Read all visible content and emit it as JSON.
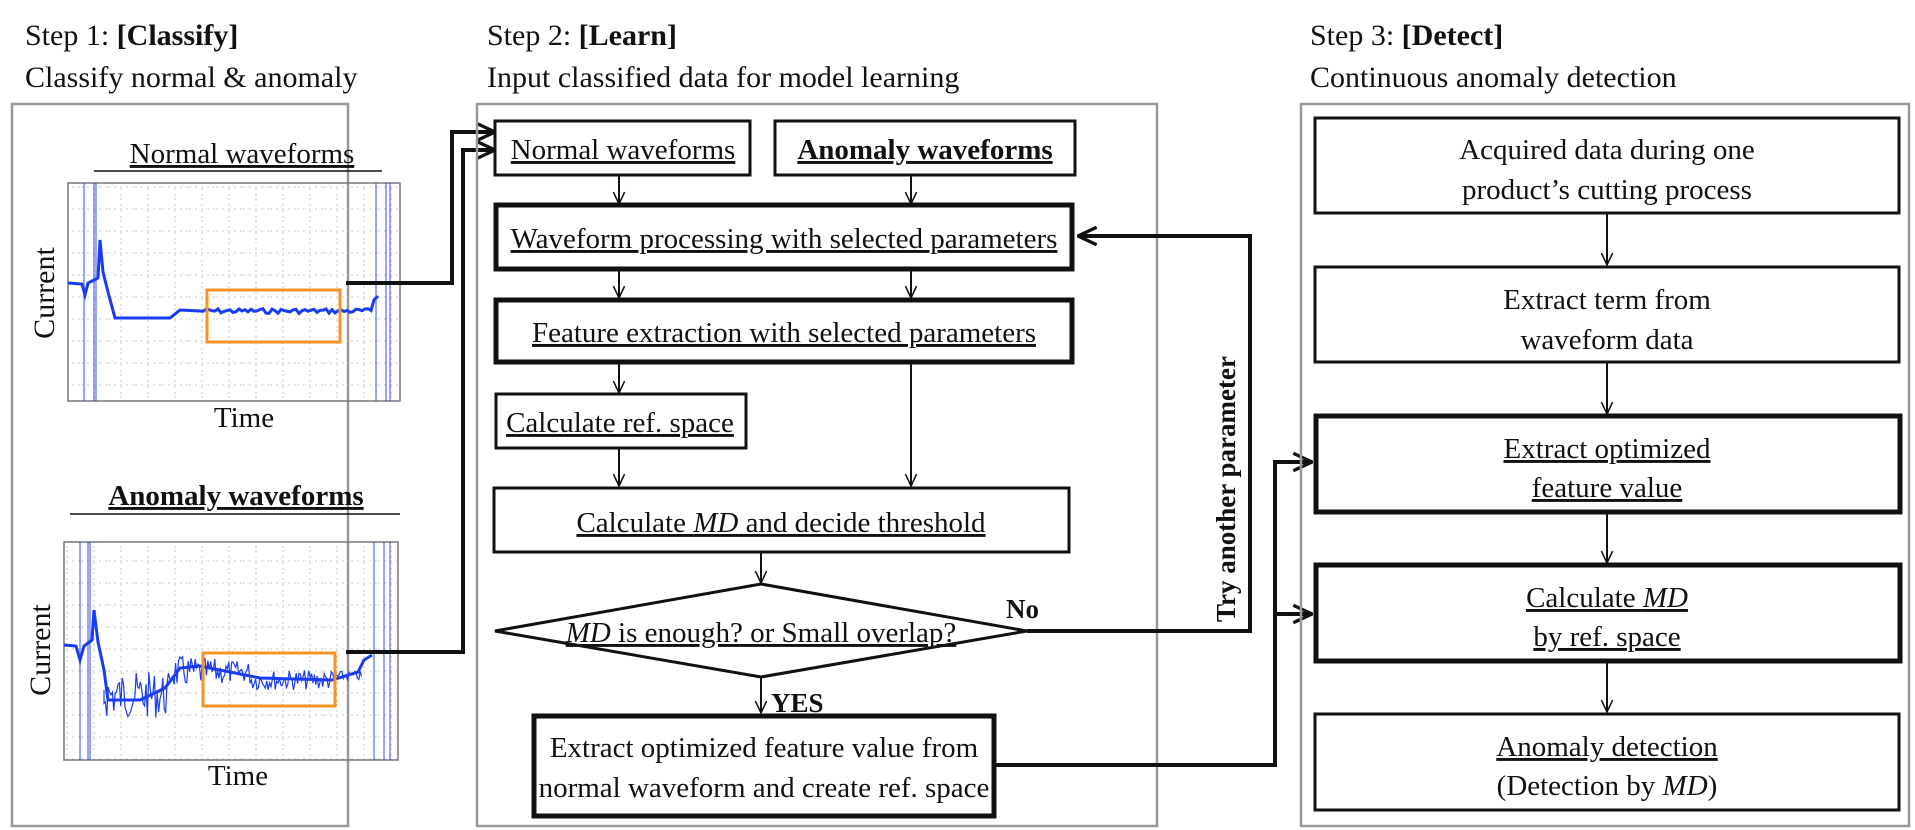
{
  "step1": {
    "prefix": "Step 1: ",
    "tag": "[Classify]",
    "subtitle": "Classify normal & anomaly",
    "normal_title": "Normal waveforms",
    "anomaly_title": "Anomaly waveforms",
    "y_label": "Current",
    "x_label": "Time",
    "waveform_color": "#1a3cf0",
    "highlight_color": "#f59324"
  },
  "step2": {
    "prefix": "Step 2: ",
    "tag": "[Learn]",
    "subtitle": "Input classified data for model learning",
    "normal_waveforms": "Normal waveforms",
    "anomaly_waveforms": "Anomaly waveforms",
    "waveform_processing": "Waveform processing with selected parameters",
    "feature_extraction": "Feature extraction with selected parameters",
    "calc_ref_space": "Calculate ref. space",
    "calc_md_pre": "Calculate ",
    "md": "MD",
    "calc_md_post": " and decide threshold",
    "decision_post": " is enough? or Small overlap?",
    "no_label": "No",
    "yes_label": "YES",
    "loop_label_1": "Try ",
    "loop_label_2": "another parameter",
    "final_line1": "Extract optimized feature value from",
    "final_line2": "normal waveform and create ref. space"
  },
  "step3": {
    "prefix": "Step 3: ",
    "tag": "[Detect]",
    "subtitle": "Continuous anomaly detection",
    "acquired_line1": "Acquired data during one",
    "acquired_line2": "product’s cutting process",
    "extract_term_line1": "Extract term from",
    "extract_term_line2": "waveform data",
    "extract_opt_line1": "Extract optimized",
    "extract_opt_line2": "feature value",
    "calc_md_line1_pre": "Calculate ",
    "md": "MD",
    "calc_md_line2": "by ref. space",
    "anomaly_line1": "Anomaly detection",
    "anomaly_line2_pre": "(Detection by ",
    "anomaly_line2_post": ")"
  }
}
